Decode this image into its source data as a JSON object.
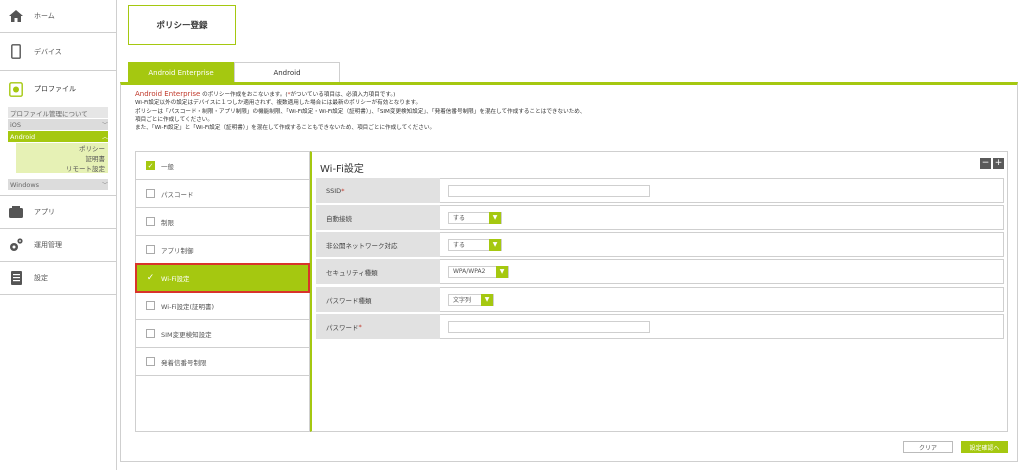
{
  "sidebar": {
    "home": {
      "label": "ホーム",
      "icon": "home-icon"
    },
    "device": {
      "label": "デバイス",
      "icon": "device-icon"
    },
    "profile": {
      "label": "プロファイル",
      "icon": "profile-icon"
    },
    "profile_management": "プロファイル管理について",
    "ios": "iOS",
    "android": "Android",
    "android_items": [
      "ポリシー",
      "証明書",
      "リモート設定"
    ],
    "windows": "Windows",
    "apps": {
      "label": "アプリ",
      "icon": "apps-icon"
    },
    "operations": {
      "label": "運用管理",
      "icon": "gear-icon"
    },
    "settings": {
      "label": "設定",
      "icon": "settings-icon"
    }
  },
  "header": {
    "title": "ポリシー登録"
  },
  "tabs": [
    {
      "label": "Android Enterprise",
      "active": true
    },
    {
      "label": "Android",
      "active": false
    }
  ],
  "notice": {
    "brand": "Android Enterprise",
    "line1_rest": " のポリシー作成をおこないます。(",
    "star": "*",
    "line1_tail": "がついている項目は、必須入力項目です。)",
    "line2": "Wi-Fi設定以外の設定はデバイスに１つしか適用されず、複数適用した場合には最新のポリシーが有効となります。",
    "line3": "ポリシーは「パスコード・制限・アプリ制限」の機能制限、「Wi-Fi設定・Wi-Fi設定（証明書）」、「SIM変更検知設定」、「発着信番号制限」を混在して作成することはできないため、",
    "line4": "項目ごとに作成してください。",
    "line5": "また、「Wi-Fi設定」と「Wi-Fi設定（証明書）」を混在して作成することもできないため、項目ごとに作成してください。"
  },
  "categories": [
    {
      "label": "一般",
      "checked": true
    },
    {
      "label": "パスコード",
      "checked": false
    },
    {
      "label": "制限",
      "checked": false
    },
    {
      "label": "アプリ制御",
      "checked": false
    },
    {
      "label": "Wi-Fi設定",
      "checked": true,
      "selected": true
    },
    {
      "label": "Wi-Fi設定(証明書)",
      "checked": false
    },
    {
      "label": "SIM変更検知設定",
      "checked": false
    },
    {
      "label": "発着信番号制限",
      "checked": false
    }
  ],
  "settings": {
    "title": "Wi-Fi設定",
    "minus": "−",
    "plus": "+",
    "fields": {
      "ssid": {
        "label": "SSID",
        "required_mark": "*",
        "value": ""
      },
      "auto_connect": {
        "label": "自動接続",
        "value": "する"
      },
      "hidden_network": {
        "label": "非公開ネットワーク対応",
        "value": "する"
      },
      "security_type": {
        "label": "セキュリティ種類",
        "value": "WPA/WPA2"
      },
      "password_type": {
        "label": "パスワード種類",
        "value": "文字列"
      },
      "password": {
        "label": "パスワード",
        "required_mark": "*",
        "value": ""
      }
    },
    "dropdown_glyph": "▼"
  },
  "footer": {
    "clear": "クリア",
    "confirm": "設定確認へ"
  },
  "colors": {
    "accent": "#a5c810",
    "highlight_border": "#d9342b",
    "required": "#c0392b"
  }
}
